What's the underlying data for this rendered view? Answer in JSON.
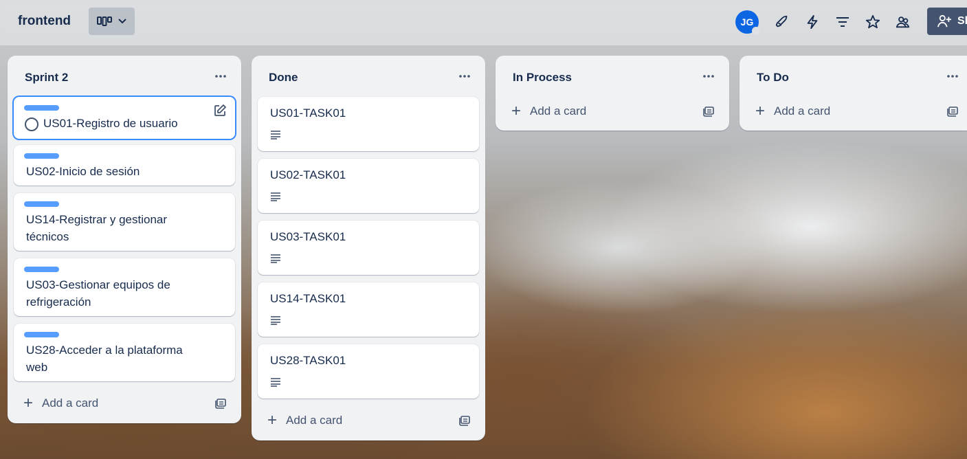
{
  "header": {
    "board_title": "frontend",
    "avatar_initials": "JG",
    "share_label": "Sh"
  },
  "icons": {
    "view": "board-view-icon",
    "chevron": "chevron-down-icon",
    "powerups": "rocket-icon",
    "automation": "lightning-icon",
    "filter": "filter-icon",
    "star": "star-icon",
    "visibility": "team-visibility-icon",
    "share": "add-person-icon",
    "menu": "more-horizontal-icon",
    "edit": "edit-icon",
    "description": "description-icon",
    "template": "card-template-icon"
  },
  "colors": {
    "label": "#579dff",
    "avatar": "#0c66e4",
    "share_button": "#44546f",
    "focus_ring": "#388bff"
  },
  "lists": [
    {
      "title": "Sprint 2",
      "cards": [
        {
          "title": "US01-Registro de usuario"
        },
        {
          "title": "US02-Inicio de sesión"
        },
        {
          "title_line1": "US14-Registrar y gestionar",
          "title_line2": "técnicos"
        },
        {
          "title_line1": "US03-Gestionar equipos de",
          "title_line2": "refrigeración"
        },
        {
          "title_line1": "US28-Acceder a la plataforma",
          "title_line2": "web"
        }
      ],
      "add_card": "Add a card"
    },
    {
      "title": "Done",
      "cards": [
        {
          "title": "US01-TASK01"
        },
        {
          "title": "US02-TASK01"
        },
        {
          "title": "US03-TASK01"
        },
        {
          "title": "US14-TASK01"
        },
        {
          "title": "US28-TASK01"
        }
      ],
      "add_card": "Add a card"
    },
    {
      "title": "In Process",
      "cards": [],
      "add_card": "Add a card"
    },
    {
      "title": "To Do",
      "cards": [],
      "add_card": "Add a card"
    }
  ]
}
